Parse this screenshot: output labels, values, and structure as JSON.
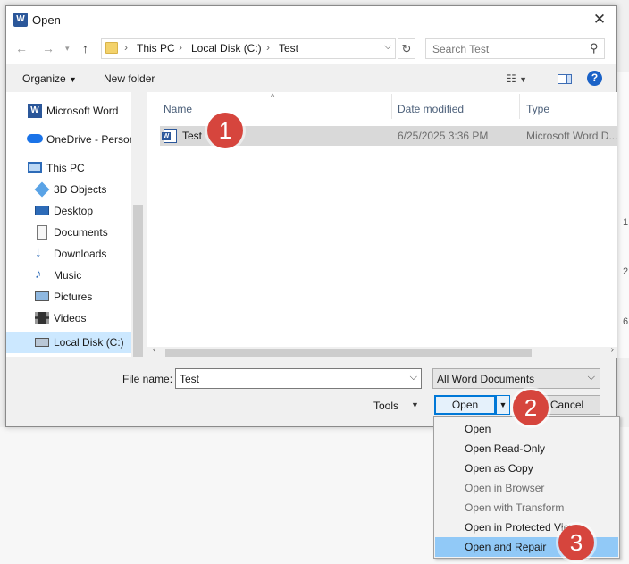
{
  "dialog": {
    "title": "Open",
    "close_icon": "close-icon",
    "address": {
      "crumbs": [
        "This PC",
        "Local Disk (C:)",
        "Test"
      ]
    },
    "search_placeholder": "Search Test",
    "toolbar": {
      "organize": "Organize",
      "new_folder": "New folder"
    },
    "navigation": [
      {
        "label": "Microsoft Word",
        "icon": "word-icon"
      },
      {
        "label": "OneDrive - Persor",
        "icon": "cloud-icon"
      },
      {
        "label": "This PC",
        "icon": "computer-icon"
      },
      {
        "label": "3D Objects",
        "icon": "cube-icon"
      },
      {
        "label": "Desktop",
        "icon": "desktop-icon"
      },
      {
        "label": "Documents",
        "icon": "documents-icon"
      },
      {
        "label": "Downloads",
        "icon": "download-icon"
      },
      {
        "label": "Music",
        "icon": "music-icon"
      },
      {
        "label": "Pictures",
        "icon": "pictures-icon"
      },
      {
        "label": "Videos",
        "icon": "videos-icon"
      },
      {
        "label": "Local Disk (C:)",
        "icon": "drive-icon",
        "selected": true
      }
    ],
    "columns": {
      "name": "Name",
      "date": "Date modified",
      "type": "Type"
    },
    "files": [
      {
        "name": "Test",
        "date": "6/25/2025 3:36 PM",
        "type": "Microsoft Word D..."
      }
    ],
    "file_name_label": "File name:",
    "file_name_value": "Test",
    "filter": "All Word Documents",
    "tools": "Tools",
    "open": "Open",
    "cancel": "Cancel"
  },
  "open_menu": [
    {
      "label": "Open",
      "enabled": true
    },
    {
      "label": "Open Read-Only",
      "enabled": true
    },
    {
      "label": "Open as Copy",
      "enabled": true
    },
    {
      "label": "Open in Browser",
      "enabled": false
    },
    {
      "label": "Open with Transform",
      "enabled": false
    },
    {
      "label": "Open in Protected View",
      "enabled": true
    },
    {
      "label": "Open and Repair",
      "enabled": true,
      "highlighted": true
    }
  ],
  "markers": [
    "1",
    "2",
    "3"
  ],
  "background": {
    "right_edge_values": [
      "1,",
      "2,",
      "6,"
    ]
  },
  "colors": {
    "accent": "#0078d7",
    "marker": "#d6453d",
    "selection": "#cce8ff",
    "menu_highlight": "#91c9f7"
  }
}
